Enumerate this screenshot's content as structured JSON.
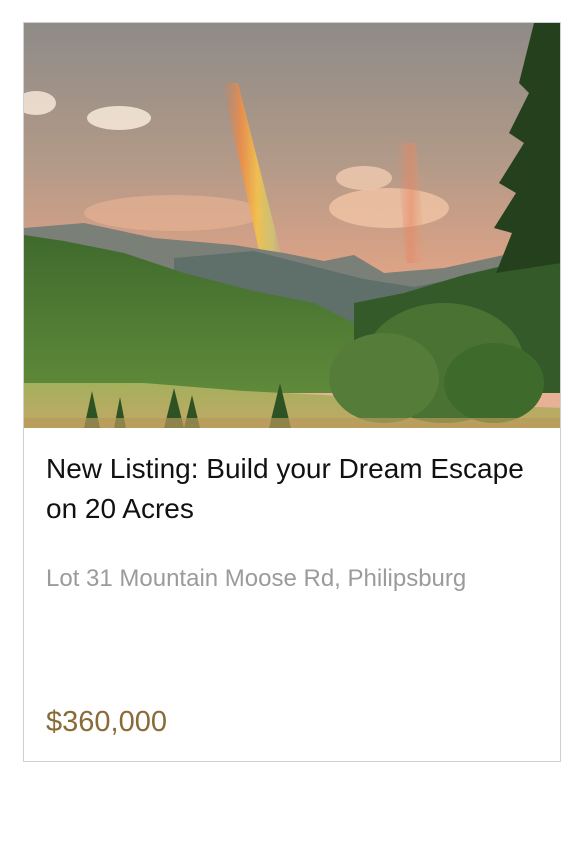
{
  "listing": {
    "title": "New Listing: Build your Dream Escape on 20 Acres",
    "address": "Lot 31 Mountain Moose Rd, Philipsburg",
    "price": "$360,000"
  },
  "colors": {
    "title": "#111111",
    "address": "#9b9b9b",
    "price": "#8a6a36",
    "border": "#cfcfcf"
  }
}
